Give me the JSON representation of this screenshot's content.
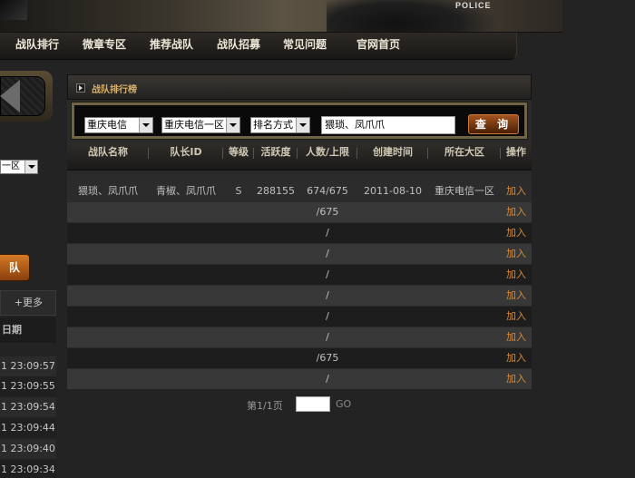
{
  "banner": {
    "badge_text": "POLICE"
  },
  "nav": {
    "items": [
      "战队排行",
      "微章专区",
      "推荐战队",
      "战队招募",
      "常见问题",
      "官网首页"
    ]
  },
  "left": {
    "select_value": "一区",
    "button_label": "队",
    "more_label": "+更多",
    "date_header": "日期",
    "times": [
      "1 23:09:57",
      "1 23:09:55",
      "1 23:09:54",
      "1 23:09:44",
      "1 23:09:40",
      "1 23:09:34"
    ]
  },
  "panel": {
    "title": "战队排行榜",
    "search": {
      "server": "重庆电信",
      "zone": "重庆电信一区",
      "sort": "排名方式",
      "keyword": "猥琐、凤爪爪",
      "button": "查 询"
    },
    "columns": [
      "战队名称",
      "队长ID",
      "等级",
      "活跃度",
      "人数/上限",
      "创建时间",
      "所在大区",
      "操作"
    ],
    "rows": [
      {
        "name": "猥琐、凤爪爪",
        "leader": "青椒、凤爪爪",
        "level": "S",
        "activity": "288155",
        "members": "674/675",
        "created": "2011-08-10",
        "region": "重庆电信一区",
        "action": "加入"
      },
      {
        "members": "/675",
        "action": "加入"
      },
      {
        "members": "/",
        "action": "加入"
      },
      {
        "members": "/",
        "action": "加入"
      },
      {
        "members": "/",
        "action": "加入"
      },
      {
        "members": "/",
        "action": "加入"
      },
      {
        "members": "/",
        "action": "加入"
      },
      {
        "members": "/",
        "action": "加入"
      },
      {
        "members": "/675",
        "action": "加入"
      },
      {
        "members": "/",
        "action": "加入"
      }
    ]
  },
  "pager": {
    "page_info": "第1/1页",
    "go_label": "GO"
  }
}
